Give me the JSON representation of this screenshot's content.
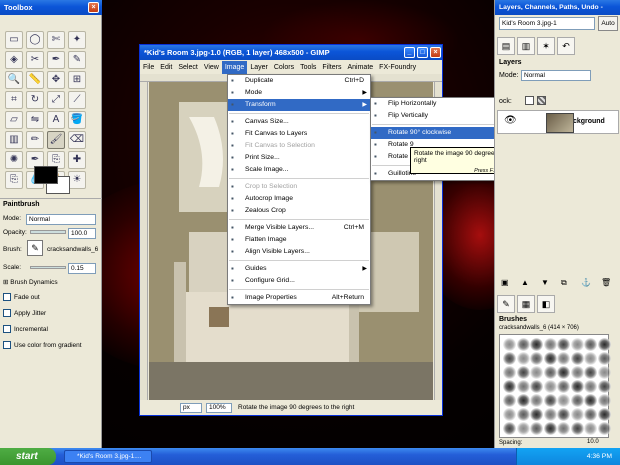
{
  "toolbox": {
    "title": "Toolbox",
    "tools": [
      "rect-select-icon",
      "ellipse-select-icon",
      "free-select-icon",
      "fuzzy-select-icon",
      "color-select-icon",
      "scissors-icon",
      "paths-icon",
      "color-picker-icon",
      "zoom-icon",
      "measure-icon",
      "move-icon",
      "align-icon",
      "crop-icon",
      "rotate-icon",
      "scale-icon",
      "shear-icon",
      "perspective-icon",
      "flip-icon",
      "text-icon",
      "bucket-fill-icon",
      "blend-icon",
      "pencil-icon",
      "paintbrush-icon",
      "eraser-icon",
      "airbrush-icon",
      "ink-icon",
      "clone-icon",
      "heal-icon",
      "perspective-clone-icon",
      "blur-icon",
      "smudge-icon",
      "dodge-burn-icon"
    ],
    "options_title": "Paintbrush",
    "mode_label": "Mode:",
    "mode_value": "Normal",
    "opacity_label": "Opacity:",
    "opacity_value": "100.0",
    "brush_label": "Brush:",
    "brush_value": "cracksandwalls_6",
    "scale_label": "Scale:",
    "scale_value": "0.15",
    "brush_dynamics": "Brush Dynamics",
    "fade_out": "Fade out",
    "apply_jitter": "Apply Jitter",
    "incremental": "Incremental",
    "use_color_gradient": "Use color from gradient"
  },
  "image_window": {
    "title": "*Kid's Room 3.jpg-1.0 (RGB, 1 layer) 468x500 - GIMP",
    "menus": [
      "File",
      "Edit",
      "Select",
      "View",
      "Image",
      "Layer",
      "Colors",
      "Tools",
      "Filters",
      "Animate",
      "FX-Foundry",
      "Script"
    ],
    "active_menu": "Image",
    "unit": "px",
    "zoom": "100%",
    "status": "Rotate the image 90 degrees to the right"
  },
  "image_menu": [
    {
      "label": "Duplicate",
      "accel": "Ctrl+D"
    },
    {
      "label": "Mode",
      "submenu": true
    },
    {
      "label": "Transform",
      "submenu": true,
      "highlight": true
    },
    {
      "sep": true
    },
    {
      "label": "Canvas Size..."
    },
    {
      "label": "Fit Canvas to Layers"
    },
    {
      "label": "Fit Canvas to Selection",
      "disabled": true
    },
    {
      "label": "Print Size..."
    },
    {
      "label": "Scale Image..."
    },
    {
      "sep": true
    },
    {
      "label": "Crop to Selection",
      "disabled": true
    },
    {
      "label": "Autocrop Image"
    },
    {
      "label": "Zealous Crop"
    },
    {
      "sep": true
    },
    {
      "label": "Merge Visible Layers...",
      "accel": "Ctrl+M"
    },
    {
      "label": "Flatten Image"
    },
    {
      "label": "Align Visible Layers..."
    },
    {
      "sep": true
    },
    {
      "label": "Guides",
      "submenu": true
    },
    {
      "label": "Configure Grid..."
    },
    {
      "sep": true
    },
    {
      "label": "Image Properties",
      "accel": "Alt+Return"
    }
  ],
  "transform_menu": [
    {
      "label": "Flip Horizontally"
    },
    {
      "label": "Flip Vertically"
    },
    {
      "sep": true
    },
    {
      "label": "Rotate 90° clockwise",
      "highlight": true
    },
    {
      "label": "Rotate 9"
    },
    {
      "label": "Rotate 1"
    },
    {
      "sep": true
    },
    {
      "label": "Guillotine"
    }
  ],
  "tooltip": {
    "text": "Rotate the image 90 degrees to the right",
    "hint": "Press F1 for more help"
  },
  "dock": {
    "title": "Layers, Channels, Paths, Undo -",
    "image_select": "Kid's Room 3.jpg-1",
    "auto_button": "Auto",
    "layers_title": "Layers",
    "mode_label": "Mode:",
    "mode_value": "Normal",
    "lock_label": "ock:",
    "layer_name": "Background",
    "brushes_title": "Brushes",
    "brush_info": "cracksandwalls_6 (414 × 706)",
    "spacing_label": "Spacing:",
    "spacing_value": "10.0"
  },
  "taskbar": {
    "start": "start",
    "task": "*Kid's Room 3.jpg-1....",
    "clock": "4:36 PM"
  }
}
